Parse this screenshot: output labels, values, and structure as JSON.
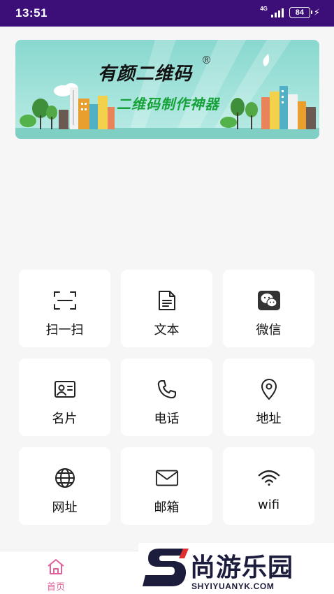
{
  "status_bar": {
    "time": "13:51",
    "network": "4G",
    "battery": "84"
  },
  "banner": {
    "title": "有颜二维码",
    "registered_mark": "®",
    "subtitle": "二维码制作神器"
  },
  "tiles": [
    {
      "label": "扫一扫",
      "icon": "scan-icon"
    },
    {
      "label": "文本",
      "icon": "document-icon"
    },
    {
      "label": "微信",
      "icon": "wechat-icon"
    },
    {
      "label": "名片",
      "icon": "business-card-icon"
    },
    {
      "label": "电话",
      "icon": "phone-icon"
    },
    {
      "label": "地址",
      "icon": "location-pin-icon"
    },
    {
      "label": "网址",
      "icon": "globe-icon"
    },
    {
      "label": "邮箱",
      "icon": "mail-icon"
    },
    {
      "label": "wifi",
      "icon": "wifi-icon"
    }
  ],
  "bottom_nav": {
    "home_label": "首页",
    "home_icon": "home-icon",
    "active_color": "#e0629a"
  },
  "watermark": {
    "name": "尚游乐园",
    "url": "SHYIYUANYK.COM"
  },
  "colors": {
    "status_bar": "#3c0f78",
    "banner_bg": "#9ee0d8",
    "subtitle": "#18a23a",
    "page_bg": "#f6f6f6"
  }
}
